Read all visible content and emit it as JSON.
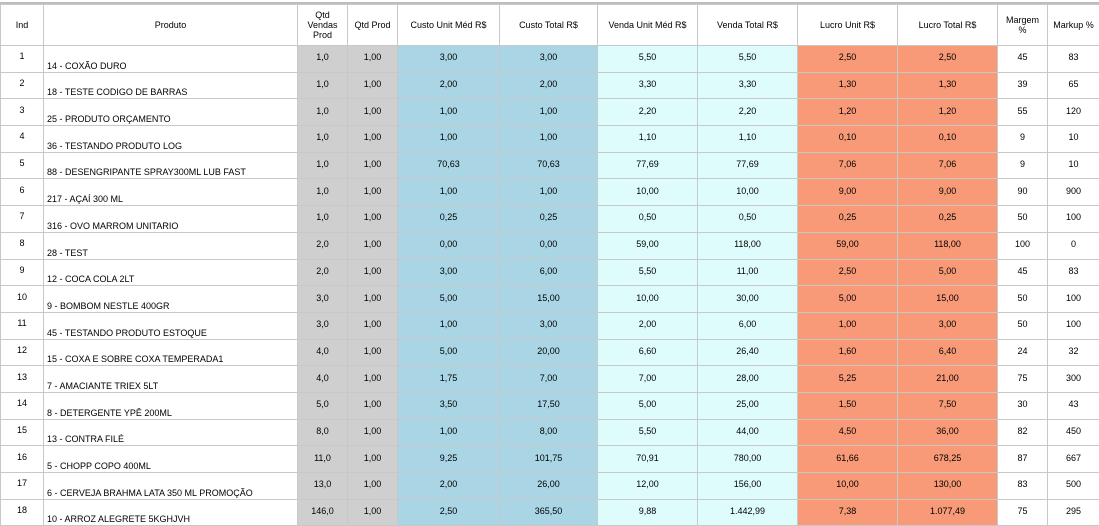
{
  "columns": [
    "Ind",
    "Produto",
    "Qtd Vendas Prod",
    "Qtd Prod",
    "Custo Unit Méd R$",
    "Custo Total R$",
    "Venda Unit Méd R$",
    "Venda Total R$",
    "Lucro Unit R$",
    "Lucro Total R$",
    "Margem %",
    "Markup %"
  ],
  "rows": [
    [
      "1",
      "14 - COXÃO DURO",
      "1,0",
      "1,00",
      "3,00",
      "3,00",
      "5,50",
      "5,50",
      "2,50",
      "2,50",
      "45",
      "83"
    ],
    [
      "2",
      "18 - TESTE CODIGO DE BARRAS",
      "1,0",
      "1,00",
      "2,00",
      "2,00",
      "3,30",
      "3,30",
      "1,30",
      "1,30",
      "39",
      "65"
    ],
    [
      "3",
      "25 - PRODUTO ORÇAMENTO",
      "1,0",
      "1,00",
      "1,00",
      "1,00",
      "2,20",
      "2,20",
      "1,20",
      "1,20",
      "55",
      "120"
    ],
    [
      "4",
      "36 - TESTANDO PRODUTO LOG",
      "1,0",
      "1,00",
      "1,00",
      "1,00",
      "1,10",
      "1,10",
      "0,10",
      "0,10",
      "9",
      "10"
    ],
    [
      "5",
      "88 - DESENGRIPANTE SPRAY300ML LUB FAST",
      "1,0",
      "1,00",
      "70,63",
      "70,63",
      "77,69",
      "77,69",
      "7,06",
      "7,06",
      "9",
      "10"
    ],
    [
      "6",
      "217 - AÇAÍ 300 ML",
      "1,0",
      "1,00",
      "1,00",
      "1,00",
      "10,00",
      "10,00",
      "9,00",
      "9,00",
      "90",
      "900"
    ],
    [
      "7",
      "316 - OVO MARROM UNITARIO",
      "1,0",
      "1,00",
      "0,25",
      "0,25",
      "0,50",
      "0,50",
      "0,25",
      "0,25",
      "50",
      "100"
    ],
    [
      "8",
      "28 - TEST",
      "2,0",
      "1,00",
      "0,00",
      "0,00",
      "59,00",
      "118,00",
      "59,00",
      "118,00",
      "100",
      "0"
    ],
    [
      "9",
      "12 - COCA COLA 2LT",
      "2,0",
      "1,00",
      "3,00",
      "6,00",
      "5,50",
      "11,00",
      "2,50",
      "5,00",
      "45",
      "83"
    ],
    [
      "10",
      "9 - BOMBOM NESTLE 400GR",
      "3,0",
      "1,00",
      "5,00",
      "15,00",
      "10,00",
      "30,00",
      "5,00",
      "15,00",
      "50",
      "100"
    ],
    [
      "11",
      "45 - TESTANDO PRODUTO ESTOQUE",
      "3,0",
      "1,00",
      "1,00",
      "3,00",
      "2,00",
      "6,00",
      "1,00",
      "3,00",
      "50",
      "100"
    ],
    [
      "12",
      "15 - COXA E SOBRE COXA TEMPERADA1",
      "4,0",
      "1,00",
      "5,00",
      "20,00",
      "6,60",
      "26,40",
      "1,60",
      "6,40",
      "24",
      "32"
    ],
    [
      "13",
      "7 - AMACIANTE TRIEX 5LT",
      "4,0",
      "1,00",
      "1,75",
      "7,00",
      "7,00",
      "28,00",
      "5,25",
      "21,00",
      "75",
      "300"
    ],
    [
      "14",
      "8 - DETERGENTE YPÊ 200ML",
      "5,0",
      "1,00",
      "3,50",
      "17,50",
      "5,00",
      "25,00",
      "1,50",
      "7,50",
      "30",
      "43"
    ],
    [
      "15",
      "13 - CONTRA FILÉ",
      "8,0",
      "1,00",
      "1,00",
      "8,00",
      "5,50",
      "44,00",
      "4,50",
      "36,00",
      "82",
      "450"
    ],
    [
      "16",
      "5 - CHOPP COPO 400ML",
      "11,0",
      "1,00",
      "9,25",
      "101,75",
      "70,91",
      "780,00",
      "61,66",
      "678,25",
      "87",
      "667"
    ],
    [
      "17",
      "6 - CERVEJA BRAHMA LATA 350 ML PROMOÇÃO",
      "13,0",
      "1,00",
      "2,00",
      "26,00",
      "12,00",
      "156,00",
      "10,00",
      "130,00",
      "83",
      "500"
    ],
    [
      "18",
      "10 - ARROZ ALEGRETE 5KGHJVH",
      "146,0",
      "1,00",
      "2,50",
      "365,50",
      "9,88",
      "1.442,99",
      "7,38",
      "1.077,49",
      "75",
      "295"
    ]
  ]
}
